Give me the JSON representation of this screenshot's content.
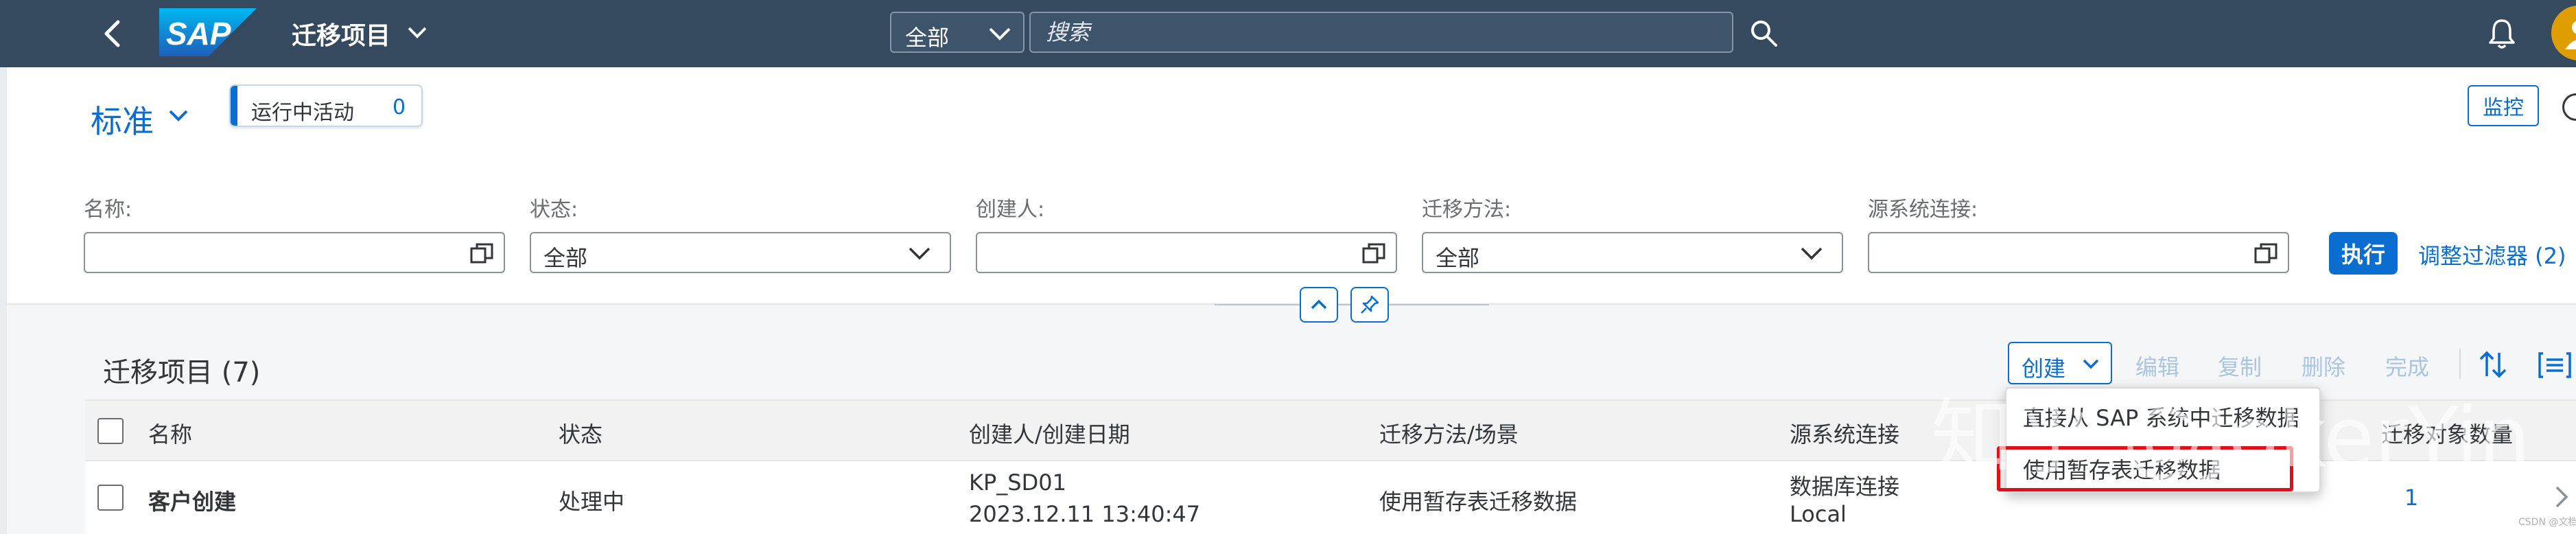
{
  "shell": {
    "logo_text": "SAP",
    "app_title": "迁移项目",
    "scope": "全部",
    "search_placeholder": "搜索"
  },
  "header": {
    "variant": "标准",
    "running_label": "运行中活动",
    "running_count": "0",
    "monitor": "监控"
  },
  "filters": [
    {
      "label": "名称:",
      "value": ""
    },
    {
      "label": "状态:",
      "value": "全部"
    },
    {
      "label": "创建人:",
      "value": ""
    },
    {
      "label": "迁移方法:",
      "value": "全部"
    },
    {
      "label": "源系统连接:",
      "value": ""
    }
  ],
  "filterbar": {
    "go": "执行",
    "adapt": "调整过滤器 (2)"
  },
  "table": {
    "title": "迁移项目 (7)",
    "toolbar": {
      "create": "创建",
      "edit": "编辑",
      "copy": "复制",
      "delete": "删除",
      "complete": "完成"
    },
    "columns": [
      "名称",
      "状态",
      "创建人/创建日期",
      "迁移方法/场景",
      "源系统连接",
      "迁移对象数量"
    ],
    "rows": [
      {
        "name": "客户创建",
        "status": "处理中",
        "creator": "KP_SD01",
        "date": "2023.12.11 13:40:47",
        "method": "使用暂存表迁移数据",
        "conn1": "数据库连接",
        "conn2": "Local",
        "count": "1"
      }
    ]
  },
  "create_menu": {
    "items": [
      "直接从 SAP 系统中迁移数据",
      "使用暂存表迁移数据"
    ]
  },
  "watermark": {
    "main": "知乎 @JokerYin",
    "small": "CSDN @文档"
  },
  "colors": {
    "shell": "#354a5f",
    "accent": "#0a6ed1",
    "highlight": "#e0101a",
    "avatar": "#e09d00"
  }
}
